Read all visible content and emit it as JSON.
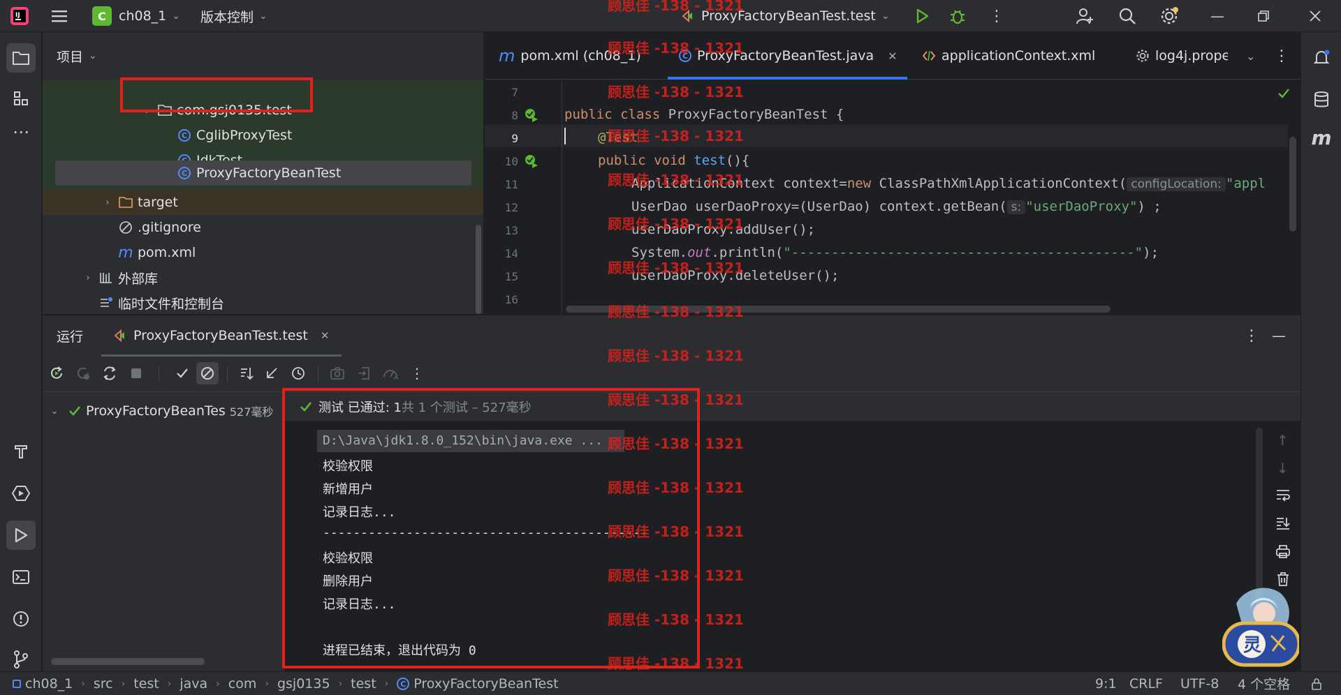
{
  "titlebar": {
    "project_badge": "C",
    "project_name": "ch08_1",
    "vcs_label": "版本控制",
    "run_config": "ProxyFactoryBeanTest.test"
  },
  "project_panel": {
    "title": "项目",
    "tree": [
      {
        "label": "com.gsj0135.test",
        "type": "package"
      },
      {
        "label": "CglibProxyTest",
        "type": "class"
      },
      {
        "label": "JdkTest",
        "type": "class"
      },
      {
        "label": "ProxyFactoryBeanTest",
        "type": "class"
      },
      {
        "label": "target",
        "type": "folder"
      },
      {
        "label": ".gitignore",
        "type": "file"
      },
      {
        "label": "pom.xml",
        "type": "maven"
      },
      {
        "label": "外部库",
        "type": "library"
      },
      {
        "label": "临时文件和控制台",
        "type": "scratch"
      }
    ]
  },
  "editor": {
    "tabs": [
      {
        "label": "pom.xml (ch08_1)"
      },
      {
        "label": "ProxyFactoryBeanTest.java"
      },
      {
        "label": "applicationContext.xml"
      },
      {
        "label": "log4j.prope"
      }
    ],
    "line_numbers": [
      "7",
      "8",
      "9",
      "10",
      "11",
      "12",
      "13",
      "14",
      "15",
      "16"
    ],
    "code": {
      "l8_kw": "public class ",
      "l8_rest": "ProxyFactoryBeanTest {",
      "l9": "@Test",
      "l10_kw": "public void ",
      "l10_fn": "test",
      "l10_rest": "(){",
      "l11_a": "ApplicationContext context=",
      "l11_kw": "new ",
      "l11_b": "ClassPathXmlApplicationContext(",
      "l11_hint": "configLocation:",
      "l11_str": "\"appl",
      "l12_a": "UserDao userDaoProxy=(UserDao) context.getBean(",
      "l12_hint": "s:",
      "l12_str": "\"userDaoProxy\"",
      "l12_b": ") ;",
      "l13": "userDaoProxy.addUser();",
      "l14_a": "System.",
      "l14_out": "out",
      "l14_b": ".println(",
      "l14_str": "\"-------------------------------------------\"",
      "l14_c": ");",
      "l15": "userDaoProxy.deleteUser();"
    }
  },
  "run_panel": {
    "title": "运行",
    "tab_label": "ProxyFactoryBeanTest.test",
    "tree_item": "ProxyFactoryBeanTes",
    "tree_time": "527毫秒",
    "status_prefix": "测试 已通过: 1",
    "status_suffix": "共 1 个测试 – 527毫秒",
    "console_lines": [
      "D:\\Java\\jdk1.8.0_152\\bin\\java.exe ...",
      "校验权限",
      "新增用户",
      "记录日志...",
      "-------------------------------------------",
      "校验权限",
      "删除用户",
      "记录日志...",
      "",
      "进程已结束，退出代码为 0"
    ]
  },
  "statusbar": {
    "breadcrumbs": [
      "ch08_1",
      "src",
      "test",
      "java",
      "com",
      "gsj0135",
      "test",
      "ProxyFactoryBeanTest"
    ],
    "position": "9:1",
    "line_sep": "CRLF",
    "encoding": "UTF-8",
    "indent": "4 个空格"
  },
  "watermark": "顾思佳 -138 - 1321",
  "colors": {
    "accent": "#3574f0",
    "success": "#5fb832",
    "highlight_box": "#e0211c"
  }
}
